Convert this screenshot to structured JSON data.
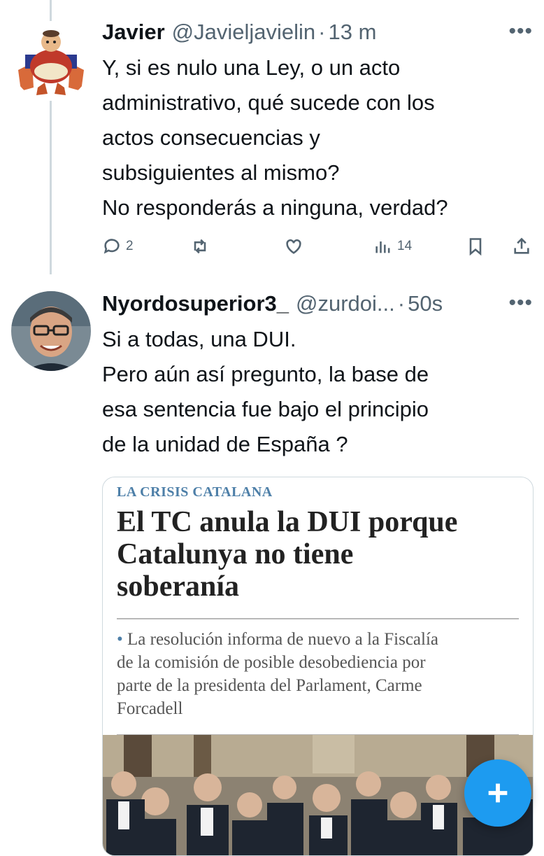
{
  "tweet1": {
    "name": "Javier",
    "handle": "@Javieljavielin",
    "time": "13 m",
    "more": "•••",
    "lines": [
      "Y, si es nulo una Ley, o un acto",
      "administrativo, qué sucede con los",
      "actos consecuencias y",
      "subsiguientes al mismo?",
      "No responderás a ninguna, verdad?"
    ],
    "replies": "2",
    "views": "14"
  },
  "tweet2": {
    "name": "Nyordosuperior3_",
    "handle": "@zurdoi...",
    "time": "50s",
    "more": "•••",
    "lines": [
      "Si a todas, una DUI.",
      "Pero aún así pregunto, la base de",
      "esa sentencia fue bajo el principio",
      "de la unidad de España ?"
    ]
  },
  "card": {
    "section": "LA CRISIS CATALANA",
    "headline_lines": [
      "El TC anula la DUI porque",
      "Catalunya no tiene",
      "soberanía"
    ],
    "bullet": "•",
    "subhead_lines": [
      "La resolución informa de nuevo a la Fiscalía",
      "de la comisión de posible desobediencia por",
      "parte de la presidenta del Parlament, Carme",
      "Forcadell"
    ]
  },
  "icons": {
    "reply": "reply-icon",
    "retweet": "retweet-icon",
    "like": "like-icon",
    "views": "views-icon",
    "bookmark": "bookmark-icon",
    "share": "share-icon",
    "compose": "plus-icon"
  },
  "colors": {
    "accent": "#1d9bf0",
    "secondary_text": "#536471",
    "section": "#4d7fa8"
  }
}
